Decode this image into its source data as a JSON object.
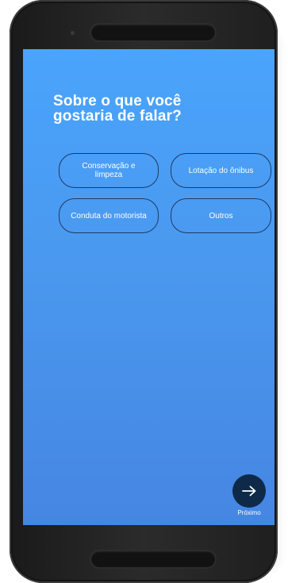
{
  "screen": {
    "question_line1": "Sobre o que você",
    "question_line2": "gostaria de falar?"
  },
  "topics": [
    {
      "line1": "Conservação e",
      "line2": "limpeza"
    },
    {
      "label": "Lotação do ônibus"
    },
    {
      "label": "Conduta do motorista"
    },
    {
      "label": "Outros"
    }
  ],
  "next_button": {
    "icon": "arrow-right-icon",
    "label": "Próximo"
  },
  "colors": {
    "screen_top": "#4aa4fb",
    "screen_bottom": "#4586e2",
    "button_border": "#1e3a63",
    "fab_background": "#0f2a49",
    "device_body": "#1f1f1f"
  }
}
